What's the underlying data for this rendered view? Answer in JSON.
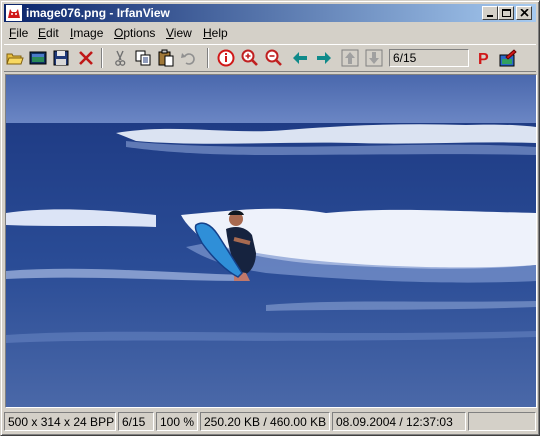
{
  "window": {
    "title": "image076.png - IrfanView",
    "app_icon": "irfanview-red-cat-icon"
  },
  "caption_buttons": {
    "minimize": "minimize-icon",
    "maximize": "maximize-icon",
    "close": "close-icon"
  },
  "menu": {
    "items": [
      {
        "label": "File",
        "underline": "F"
      },
      {
        "label": "Edit",
        "underline": "E"
      },
      {
        "label": "Image",
        "underline": "I"
      },
      {
        "label": "Options",
        "underline": "O"
      },
      {
        "label": "View",
        "underline": "V"
      },
      {
        "label": "Help",
        "underline": "H"
      }
    ]
  },
  "toolbar": {
    "buttons": [
      "open-folder-icon",
      "slideshow-icon",
      "save-icon",
      "delete-icon",
      "cut-icon",
      "copy-icon",
      "paste-icon",
      "undo-icon",
      "info-icon",
      "zoom-in-icon",
      "zoom-out-icon",
      "previous-icon",
      "next-icon",
      "first-file-icon",
      "last-file-icon",
      "print-icon",
      "paint-icon"
    ],
    "page_indicator": "6/15",
    "colors": {
      "teal_arrow": "#0f8a8a",
      "red": "#d01818",
      "magnifier": "#c02020"
    }
  },
  "image": {
    "description_icon": "surfer-photo",
    "colors": {
      "sky": "#5b78b8",
      "sea": "#2f4f99",
      "foam": "#e8eef8"
    }
  },
  "status": {
    "dimensions": "500 x 314 x 24 BPP",
    "index": "6/15",
    "zoom": "100 %",
    "size": "250.20 KB / 460.00 KB",
    "datetime": "08.09.2004 / 12:37:03"
  }
}
